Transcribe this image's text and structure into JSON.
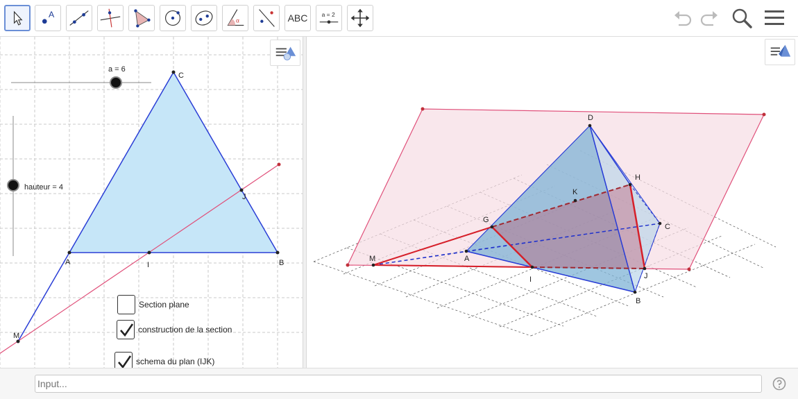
{
  "toolbar": {
    "tools": [
      {
        "name": "move-tool",
        "icon": "cursor-arrow-icon"
      },
      {
        "name": "point-tool",
        "icon": "point-icon",
        "glyph": "A"
      },
      {
        "name": "line-tool",
        "icon": "line-through-points-icon"
      },
      {
        "name": "perpendicular-tool",
        "icon": "perpendicular-line-icon"
      },
      {
        "name": "polygon-tool",
        "icon": "polygon-icon"
      },
      {
        "name": "circle-tool",
        "icon": "circle-center-point-icon"
      },
      {
        "name": "conic-tool",
        "icon": "ellipse-icon"
      },
      {
        "name": "angle-tool",
        "icon": "angle-icon",
        "glyph": "α"
      },
      {
        "name": "reflect-tool",
        "icon": "reflect-about-line-icon"
      },
      {
        "name": "text-tool",
        "icon": "text-icon",
        "glyph": "ABC"
      },
      {
        "name": "slider-tool",
        "icon": "slider-icon",
        "glyph": "a = 2"
      },
      {
        "name": "move-graphics-tool",
        "icon": "move-graphics-view-icon"
      }
    ],
    "right": [
      "undo-icon",
      "redo-icon",
      "search-icon",
      "menu-icon"
    ]
  },
  "view2d": {
    "slider_a": "a = 6",
    "slider_hauteur": "hauteur = 4",
    "points": {
      "A": "A",
      "B": "B",
      "C": "C",
      "I": "I",
      "J": "J",
      "M": "M"
    },
    "checkboxes": [
      {
        "label": "Section plane",
        "checked": false
      },
      {
        "label": "construction de la section",
        "checked": true
      },
      {
        "label": "schema du plan (IJK)",
        "checked": true
      }
    ]
  },
  "view3d": {
    "points": {
      "A": "A",
      "B": "B",
      "C": "C",
      "D": "D",
      "G": "G",
      "H": "H",
      "I": "I",
      "J": "J",
      "K": "K",
      "M": "M"
    }
  },
  "colors": {
    "triangle_fill": "#c6e6f8",
    "triangle_stroke": "#2a3ed6",
    "plane_fill": "#f6dde4",
    "plane_stroke": "#e0507a",
    "section_red": "#d6202a",
    "dashed_blue": "#2233cc",
    "tetra_fill": "#7fb3d5"
  },
  "inputbar": {
    "placeholder": "Input..."
  }
}
